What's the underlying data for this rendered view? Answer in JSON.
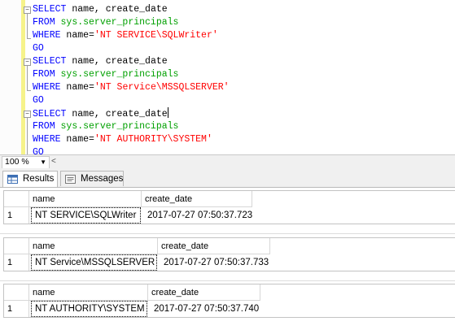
{
  "editor": {
    "lines": [
      [
        {
          "t": "SELECT",
          "c": "kw"
        },
        {
          "t": " name, create_date",
          "c": "txt"
        }
      ],
      [
        {
          "t": "FROM",
          "c": "kw"
        },
        {
          "t": " sys.server_principals",
          "c": "sys"
        }
      ],
      [
        {
          "t": "WHERE",
          "c": "kw"
        },
        {
          "t": " name=",
          "c": "txt"
        },
        {
          "t": "'NT SERVICE\\SQLWriter'",
          "c": "str"
        }
      ],
      [
        {
          "t": "GO",
          "c": "kw"
        }
      ],
      [
        {
          "t": "SELECT",
          "c": "kw"
        },
        {
          "t": " name, create_date",
          "c": "txt"
        }
      ],
      [
        {
          "t": "FROM",
          "c": "kw"
        },
        {
          "t": " sys.server_principals",
          "c": "sys"
        }
      ],
      [
        {
          "t": "WHERE",
          "c": "kw"
        },
        {
          "t": " name=",
          "c": "txt"
        },
        {
          "t": "'NT Service\\MSSQLSERVER'",
          "c": "str"
        }
      ],
      [
        {
          "t": "GO",
          "c": "kw"
        }
      ],
      [
        {
          "t": "SELECT",
          "c": "kw"
        },
        {
          "t": " name, create_date",
          "c": "txt"
        },
        {
          "t": "|",
          "c": "caret"
        }
      ],
      [
        {
          "t": "FROM",
          "c": "kw"
        },
        {
          "t": " sys.server_principals",
          "c": "sys"
        }
      ],
      [
        {
          "t": "WHERE",
          "c": "kw"
        },
        {
          "t": " name=",
          "c": "txt"
        },
        {
          "t": "'NT AUTHORITY\\SYSTEM'",
          "c": "str"
        }
      ],
      [
        {
          "t": "GO",
          "c": "kw"
        }
      ]
    ]
  },
  "zoom": {
    "value": "100 %",
    "arrow_icon": "dropdown-arrow-icon",
    "scroll_icon": "scroll-left-icon"
  },
  "tabs": [
    {
      "label": "Results",
      "icon": "results-grid-icon"
    },
    {
      "label": "Messages",
      "icon": "messages-icon"
    }
  ],
  "results": [
    {
      "headers": [
        "name",
        "create_date"
      ],
      "rows": [
        {
          "num": "1",
          "name": "NT SERVICE\\SQLWriter",
          "create_date": "2017-07-27 07:50:37.723"
        }
      ]
    },
    {
      "headers": [
        "name",
        "create_date"
      ],
      "rows": [
        {
          "num": "1",
          "name": "NT Service\\MSSQLSERVER",
          "create_date": "2017-07-27 07:50:37.733"
        }
      ]
    },
    {
      "headers": [
        "name",
        "create_date"
      ],
      "rows": [
        {
          "num": "1",
          "name": "NT AUTHORITY\\SYSTEM",
          "create_date": "2017-07-27 07:50:37.740"
        }
      ]
    }
  ]
}
